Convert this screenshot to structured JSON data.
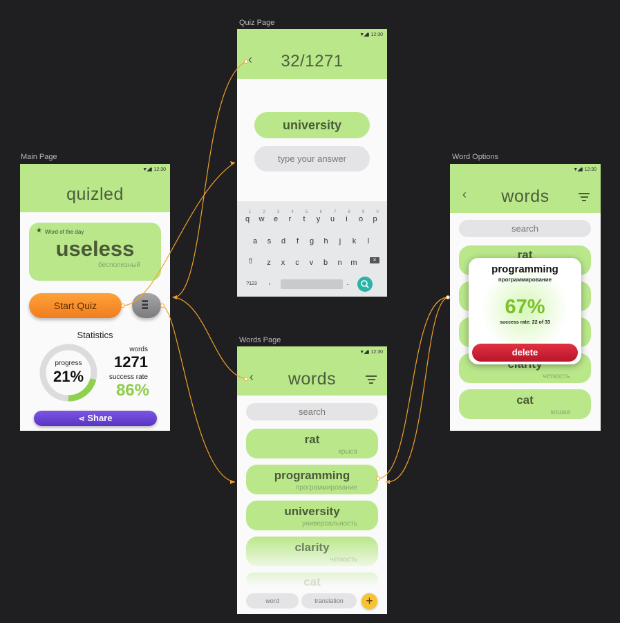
{
  "labels": {
    "main_page": "Main Page",
    "quiz_page": "Quiz Page",
    "words_page": "Words Page",
    "word_options": "Word Options"
  },
  "status_time": "12:30",
  "main": {
    "title": "quizled",
    "wotd_label": "Word of the day",
    "wotd_word": "useless",
    "wotd_translation": "бесполезный",
    "start_quiz": "Start Quiz",
    "stats_title": "Statistics",
    "progress_label": "progress",
    "progress_value": "21%",
    "progress_fraction": 0.21,
    "words_label": "words",
    "words_value": "1271",
    "success_label": "success rate",
    "success_value": "86%",
    "share": "Share"
  },
  "quiz": {
    "counter": "32/1271",
    "word": "university",
    "answer_placeholder": "type your answer",
    "row1": [
      "q",
      "w",
      "e",
      "r",
      "t",
      "y",
      "u",
      "i",
      "o",
      "p"
    ],
    "row1_nums": [
      "1",
      "2",
      "3",
      "4",
      "5",
      "6",
      "7",
      "8",
      "9",
      "0"
    ],
    "row2": [
      "a",
      "s",
      "d",
      "f",
      "g",
      "h",
      "j",
      "k",
      "l"
    ],
    "row3": [
      "z",
      "x",
      "c",
      "v",
      "b",
      "n",
      "m"
    ],
    "symbols_key": "?123",
    "comma": ",",
    "period": "."
  },
  "words_page": {
    "title": "words",
    "search": "search",
    "items": [
      {
        "word": "rat",
        "translation": "крыса"
      },
      {
        "word": "programming",
        "translation": "программирование"
      },
      {
        "word": "university",
        "translation": "универсальность"
      },
      {
        "word": "clarity",
        "translation": "четкость"
      },
      {
        "word": "cat",
        "translation": ""
      }
    ],
    "word_field": "word",
    "translation_field": "translation"
  },
  "options": {
    "title": "words",
    "search": "search",
    "bg_items": [
      {
        "word": "rat",
        "translation": ""
      },
      {
        "word": "",
        "translation": ""
      },
      {
        "word": "",
        "translation": ""
      },
      {
        "word": "clarity",
        "translation": "четкость"
      },
      {
        "word": "cat",
        "translation": "кошка"
      }
    ],
    "popup_word": "programming",
    "popup_translation": "программирование",
    "popup_percent": "67%",
    "popup_rate": "success rate: 22 of 33",
    "delete": "delete"
  },
  "colors": {
    "background": "#1f1f21",
    "appbar": "#b9e78a",
    "orange": "#f5922b",
    "purple": "#6c42d4",
    "delete_red": "#d2202f",
    "percent_green": "#7cc02a",
    "connector": "#f0a02a"
  }
}
